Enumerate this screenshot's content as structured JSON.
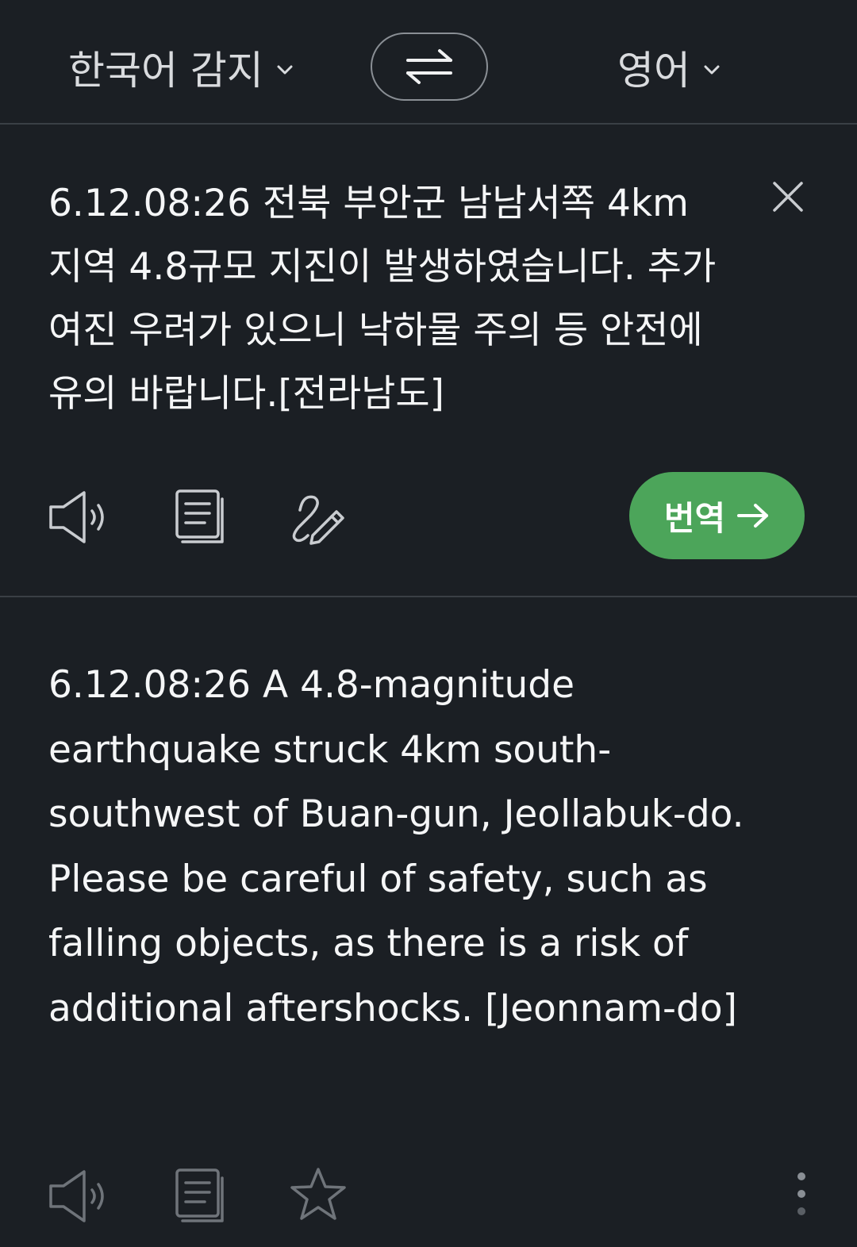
{
  "language_bar": {
    "source_language": "한국어 감지",
    "target_language": "영어",
    "swap_icon": "swap-arrows-icon",
    "dropdown_icon": "chevron-down-icon"
  },
  "source": {
    "text": "6.12.08:26 전북 부안군 남남서쪽 4km 지역 4.8규모 지진이 발생하였습니다. 추가 여진 우려가 있으니 낙하물 주의 등 안전에 유의 바랍니다.[전라남도]",
    "actions": [
      "speaker-icon",
      "copy-icon",
      "handwriting-icon",
      "close-icon"
    ],
    "translate_button_label": "번역",
    "translate_button_icon": "arrow-right-icon"
  },
  "result": {
    "text": "6.12.08:26 A 4.8-magnitude earthquake struck 4km south-southwest of Buan-gun, Jeollabuk-do. Please be careful of safety, such as falling objects, as there is a risk of additional aftershocks. [Jeonnam-do]",
    "actions": [
      "speaker-icon",
      "copy-icon",
      "star-icon",
      "more-vertical-icon"
    ]
  },
  "colors": {
    "background": "#1b1f24",
    "divider": "#3a3f45",
    "accent_green": "#4ca55a",
    "text": "#f5f6f7"
  }
}
